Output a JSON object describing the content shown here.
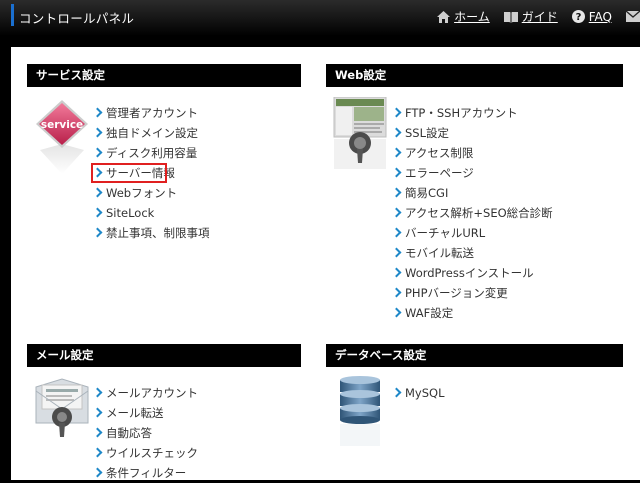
{
  "header": {
    "title": "コントロールパネル",
    "nav": [
      {
        "label": "ホーム",
        "icon": "home-icon"
      },
      {
        "label": "ガイド",
        "icon": "book-icon"
      },
      {
        "label": "FAQ",
        "icon": "help-icon"
      }
    ],
    "mail_icon": "mail-icon"
  },
  "panels": {
    "service": {
      "title": "サービス設定",
      "image_text": "service",
      "links": [
        "管理者アカウント",
        "独自ドメイン設定",
        "ディスク利用容量",
        "サーバー情報",
        "Webフォント",
        "SiteLock",
        "禁止事項、制限事項"
      ],
      "highlighted": "サーバー情報"
    },
    "web": {
      "title": "Web設定",
      "links": [
        "FTP・SSHアカウント",
        "SSL設定",
        "アクセス制限",
        "エラーページ",
        "簡易CGI",
        "アクセス解析+SEO総合診断",
        "バーチャルURL",
        "モバイル転送",
        "WordPressインストール",
        "PHPバージョン変更",
        "WAF設定"
      ]
    },
    "mail": {
      "title": "メール設定",
      "links": [
        "メールアカウント",
        "メール転送",
        "自動応答",
        "ウイルスチェック",
        "条件フィルター"
      ]
    },
    "database": {
      "title": "データベース設定",
      "links": [
        "MySQL"
      ]
    }
  },
  "colors": {
    "header_bg": "#141414",
    "panel_bar": "#000000",
    "link_chevron": "#1e88c8",
    "highlight_border": "#e02020",
    "accent": "#1a6fd0"
  }
}
